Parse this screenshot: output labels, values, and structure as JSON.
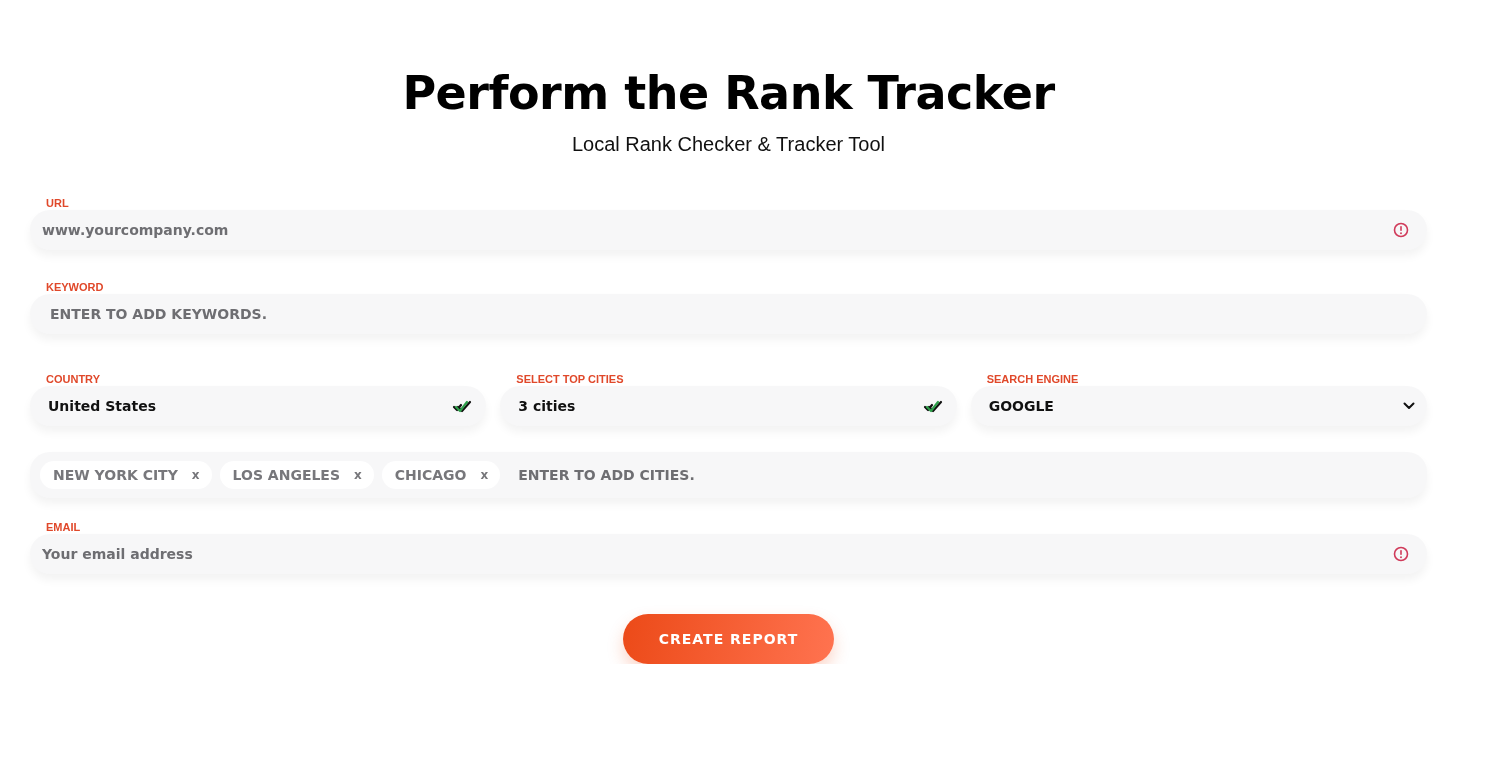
{
  "title": "Perform the Rank Tracker",
  "subtitle": "Local Rank Checker & Tracker Tool",
  "url": {
    "label": "URL",
    "placeholder": "www.yourcompany.com",
    "invalid": true
  },
  "keyword": {
    "label": "KEYWORD",
    "placeholder": "ENTER TO ADD KEYWORDS."
  },
  "selects": [
    {
      "label": "COUNTRY",
      "value": "United States",
      "kind": "check"
    },
    {
      "label": "SELECT TOP CITIES",
      "value": "3 cities",
      "kind": "check"
    },
    {
      "label": "SEARCH ENGINE",
      "value": "GOOGLE",
      "kind": "chevron"
    }
  ],
  "cities": {
    "tags": [
      {
        "label": "NEW YORK CITY",
        "remove": "x"
      },
      {
        "label": "LOS ANGELES",
        "remove": "x"
      },
      {
        "label": "CHICAGO",
        "remove": "x"
      }
    ],
    "placeholder": "ENTER TO ADD CITIES."
  },
  "email": {
    "label": "EMAIL",
    "placeholder": "Your email address",
    "invalid": true
  },
  "submit": "CREATE REPORT"
}
